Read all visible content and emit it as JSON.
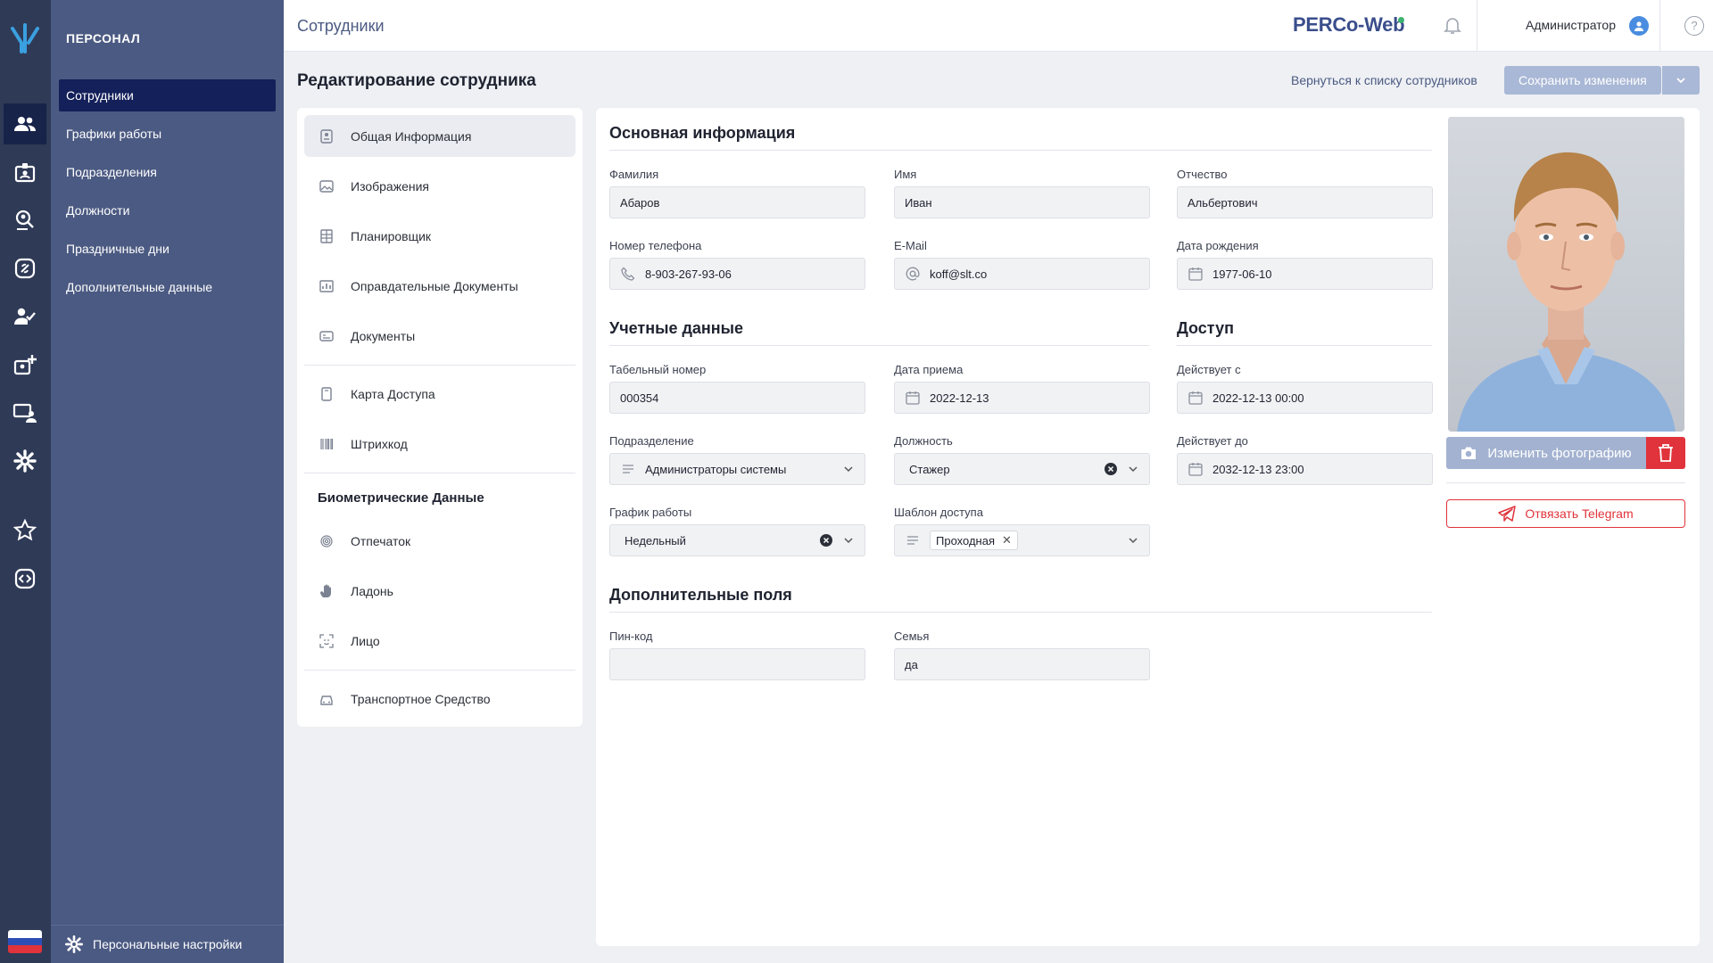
{
  "menu": {
    "section_title": "ПЕРСОНАЛ",
    "items": [
      {
        "label": "Сотрудники"
      },
      {
        "label": "Графики работы"
      },
      {
        "label": "Подразделения"
      },
      {
        "label": "Должности"
      },
      {
        "label": "Праздничные дни"
      },
      {
        "label": "Дополнительные данные"
      }
    ],
    "personal_settings": "Персональные настройки"
  },
  "topbar": {
    "breadcrumb": "Сотрудники",
    "brand": "PERCo-Web",
    "user": "Администратор",
    "help": "?"
  },
  "page": {
    "title": "Редактирование сотрудника",
    "back_link": "Вернуться к списку сотрудников",
    "save_label": "Сохранить изменения"
  },
  "tabs": {
    "items": [
      {
        "label": "Общая Информация"
      },
      {
        "label": "Изображения"
      },
      {
        "label": "Планировщик"
      },
      {
        "label": "Оправдательные Документы"
      },
      {
        "label": "Документы"
      },
      {
        "label": "Карта Доступа"
      },
      {
        "label": "Штрихкод"
      },
      {
        "label": "Отпечаток"
      },
      {
        "label": "Ладонь"
      },
      {
        "label": "Лицо"
      },
      {
        "label": "Транспортное Средство"
      }
    ],
    "biometric_group": "Биометрические Данные"
  },
  "form": {
    "basic": {
      "title": "Основная информация",
      "last_name": {
        "label": "Фамилия",
        "value": "Абаров"
      },
      "first_name": {
        "label": "Имя",
        "value": "Иван"
      },
      "middle_name": {
        "label": "Отчество",
        "value": "Альбертович"
      },
      "phone": {
        "label": "Номер телефона",
        "value": "8-903-267-93-06"
      },
      "email": {
        "label": "E-Mail",
        "value": "koff@slt.co"
      },
      "birth_date": {
        "label": "Дата рождения",
        "value": "1977-06-10"
      }
    },
    "account": {
      "title": "Учетные данные",
      "tab_number": {
        "label": "Табельный номер",
        "value": "000354"
      },
      "hire_date": {
        "label": "Дата приема",
        "value": "2022-12-13"
      },
      "division": {
        "label": "Подразделение",
        "value": "Администраторы системы"
      },
      "position": {
        "label": "Должность",
        "value": "Стажер"
      },
      "schedule": {
        "label": "График работы",
        "value": "Недельный"
      },
      "access_template": {
        "label": "Шаблон доступа",
        "value": "Проходная"
      }
    },
    "access": {
      "title": "Доступ",
      "valid_from": {
        "label": "Действует с",
        "value": "2022-12-13 00:00"
      },
      "valid_to": {
        "label": "Действует до",
        "value": "2032-12-13 23:00"
      }
    },
    "extra": {
      "title": "Дополнительные поля",
      "pin": {
        "label": "Пин-код",
        "value": ""
      },
      "family": {
        "label": "Семья",
        "value": "да"
      }
    }
  },
  "photo": {
    "change_label": "Изменить фотографию",
    "telegram_label": "Отвязать Telegram"
  },
  "colors": {
    "rail": "#2f3a57",
    "menu": "#4b5a82",
    "menu_active": "#14205a",
    "primary_disabled": "#a9b8d6",
    "danger": "#e0333b"
  }
}
